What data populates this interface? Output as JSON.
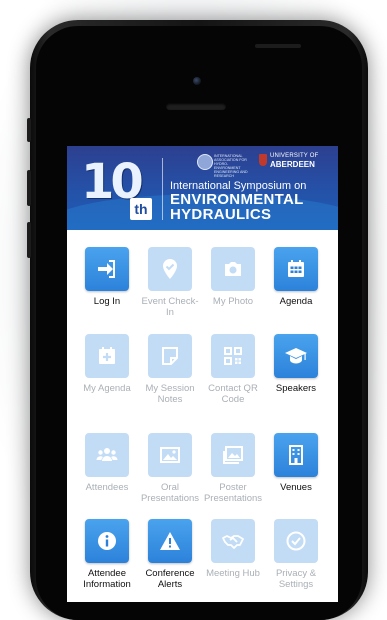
{
  "banner": {
    "number": "10",
    "suffix": "th",
    "org_logo_text": "INTERNATIONAL ASSOCIATION FOR HYDRO-ENVIRONMENT ENGINEERING AND RESEARCH",
    "university_line1": "UNIVERSITY OF",
    "university_line2": "ABERDEEN",
    "subtitle": "International Symposium on",
    "title_line1": "ENVIRONMENTAL",
    "title_line2": "HYDRAULICS"
  },
  "tiles": [
    {
      "label": "Log In",
      "icon": "login-icon",
      "enabled": true
    },
    {
      "label": "Event Check-In",
      "icon": "checkin-icon",
      "enabled": false
    },
    {
      "label": "My Photo",
      "icon": "camera-icon",
      "enabled": false
    },
    {
      "label": "Agenda",
      "icon": "calendar-icon",
      "enabled": true
    },
    {
      "label": "My Agenda",
      "icon": "my-agenda-icon",
      "enabled": false
    },
    {
      "label": "My Session Notes",
      "icon": "notes-icon",
      "enabled": false
    },
    {
      "label": "Contact QR Code",
      "icon": "qr-code-icon",
      "enabled": false
    },
    {
      "label": "Speakers",
      "icon": "graduation-cap-icon",
      "enabled": true
    },
    {
      "label": "Attendees",
      "icon": "people-icon",
      "enabled": false
    },
    {
      "label": "Oral Presentations",
      "icon": "image-icon",
      "enabled": false
    },
    {
      "label": "Poster Presentations",
      "icon": "images-icon",
      "enabled": false
    },
    {
      "label": "Venues",
      "icon": "building-icon",
      "enabled": true
    },
    {
      "label": "Attendee Information",
      "icon": "info-icon",
      "enabled": true
    },
    {
      "label": "Conference Alerts",
      "icon": "alert-icon",
      "enabled": true
    },
    {
      "label": "Meeting Hub",
      "icon": "handshake-icon",
      "enabled": false
    },
    {
      "label": "Privacy & Settings",
      "icon": "check-circle-icon",
      "enabled": false
    }
  ],
  "colors": {
    "tile_active": "#2c82da",
    "tile_disabled": "#c2dcf6",
    "banner": "#2452a9"
  }
}
